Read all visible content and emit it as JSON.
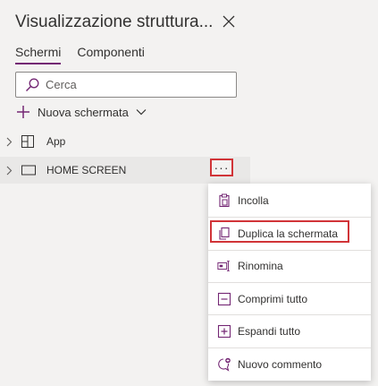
{
  "pane": {
    "title": "Visualizzazione struttura...",
    "tabs": [
      {
        "label": "Schermi",
        "active": true
      },
      {
        "label": "Componenti",
        "active": false
      }
    ],
    "search": {
      "placeholder": "Cerca"
    },
    "new_screen_label": "Nuova schermata",
    "tree": [
      {
        "label": "App",
        "icon": "app-icon"
      },
      {
        "label": "HOME SCREEN",
        "icon": "screen-icon",
        "selected": true
      }
    ]
  },
  "context_menu": {
    "items": [
      {
        "label": "Incolla",
        "icon": "paste-icon"
      },
      {
        "label": "Duplica la schermata",
        "icon": "duplicate-icon",
        "highlighted": true
      },
      {
        "label": "Rinomina",
        "icon": "rename-icon"
      },
      {
        "label": "Comprimi tutto",
        "icon": "collapse-all-icon"
      },
      {
        "label": "Espandi tutto",
        "icon": "expand-all-icon"
      },
      {
        "label": "Nuovo commento",
        "icon": "comment-icon"
      }
    ]
  },
  "colors": {
    "accent": "#742774",
    "highlight_border": "#d13438",
    "pane_bg": "#f3f2f1",
    "selected_row_bg": "#e9e8e7"
  }
}
